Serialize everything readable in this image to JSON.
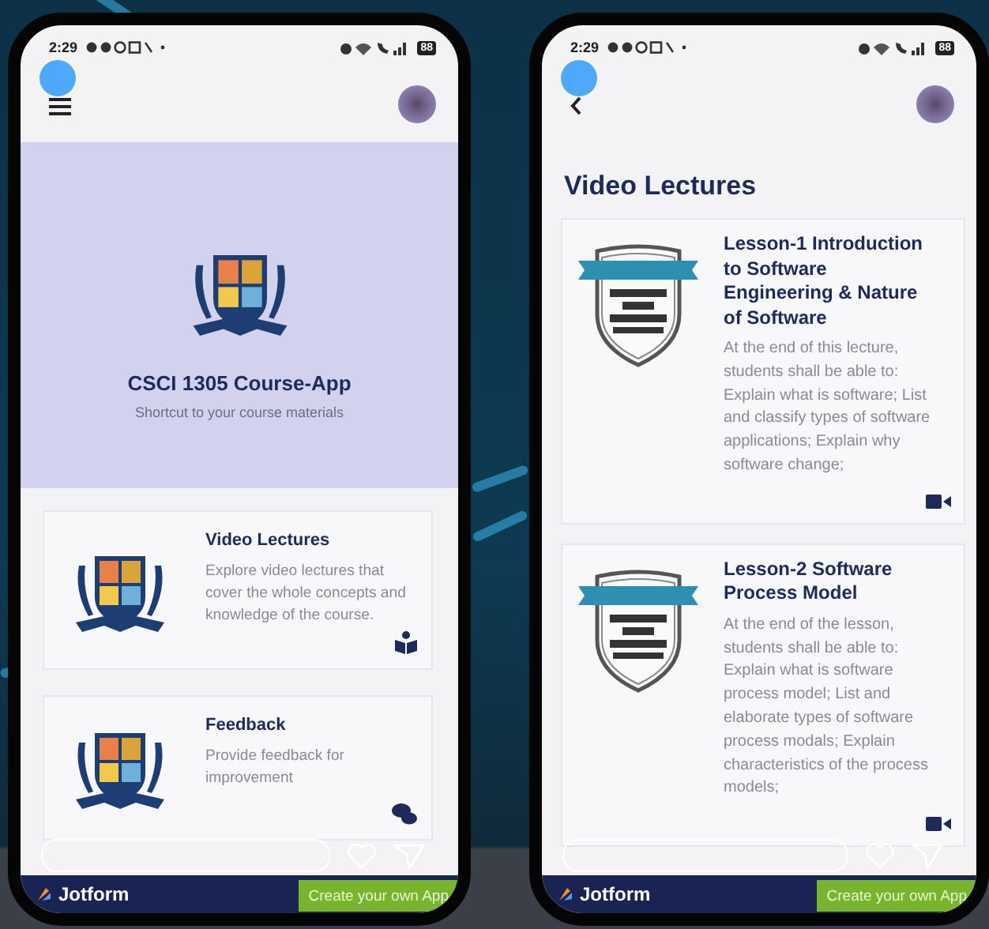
{
  "phones": [
    {
      "status_bar": {
        "time": "2:29",
        "battery": "88"
      },
      "nav": {
        "kind": "menu"
      },
      "hero": {
        "title": "CSCI 1305 Course-App",
        "subtitle": "Shortcut to your course materials"
      },
      "cards": [
        {
          "kind": "crest",
          "title": "Video Lectures",
          "description": "Explore video lectures that cover the whole concepts and knowledge of the course."
        },
        {
          "kind": "crest",
          "title": "Feedback",
          "description": "Provide feedback for improvement"
        }
      ],
      "banner": {
        "brand": "Jotform",
        "button": "Create your own App"
      }
    },
    {
      "status_bar": {
        "time": "2:29",
        "battery": "88"
      },
      "nav": {
        "kind": "back"
      },
      "heading": "Video Lectures",
      "cards": [
        {
          "kind": "lesson",
          "title": "Lesson-1 Introduction to Software Engineering & Nature of Software",
          "description": "At the end of this lecture, students shall be able to: Explain what is software; List and classify types of software applications; Explain why software change;"
        },
        {
          "kind": "lesson",
          "title": "Lesson-2 Software Process Model",
          "description": "At the end of the lesson, students shall be able to: Explain what is software process model; List and elaborate types of software process modals; Explain characteristics of the process models;"
        }
      ],
      "banner": {
        "brand": "Jotform",
        "button": "Create your own App"
      }
    }
  ]
}
